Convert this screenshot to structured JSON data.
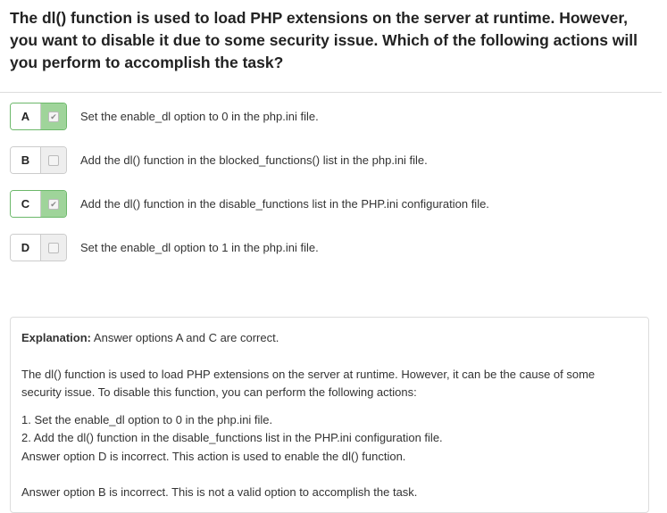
{
  "question": "The dl() function is used to load PHP extensions on the server at runtime. However, you want to disable it due to some security issue. Which of the following actions will you perform to accomplish the task?",
  "options": [
    {
      "letter": "A",
      "text": "Set the enable_dl option to 0 in the php.ini file.",
      "checked": true
    },
    {
      "letter": "B",
      "text": "Add the dl() function in the blocked_functions() list in the php.ini file.",
      "checked": false
    },
    {
      "letter": "C",
      "text": "Add the dl() function in the disable_functions list in the PHP.ini configuration file.",
      "checked": true
    },
    {
      "letter": "D",
      "text": "Set the enable_dl option to 1 in the php.ini file.",
      "checked": false
    }
  ],
  "explanation": {
    "label": "Explanation:",
    "summary": "Answer options A and C are correct.",
    "para1": "The dl() function is used to load PHP extensions on the server at runtime. However, it can be the cause of some security issue. To disable this function, you can perform the following actions:",
    "step1": "1. Set the enable_dl option to 0 in the php.ini file.",
    "step2": "2. Add the dl() function in the disable_functions list in the PHP.ini configuration file.",
    "incorrect_d": "Answer option D is incorrect. This action is used to enable the dl() function.",
    "incorrect_b": "Answer option B is incorrect. This is not a valid option to accomplish the task."
  }
}
